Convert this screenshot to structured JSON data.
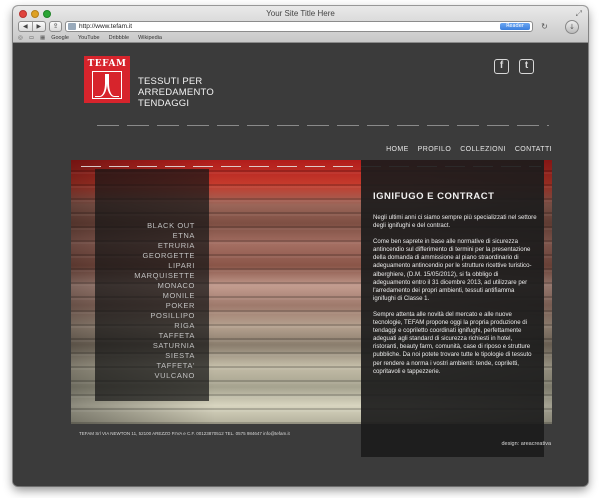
{
  "browser": {
    "window_title": "Your Site Title Here",
    "url": "http://www.tefam.it",
    "reader_label": "Reader",
    "bookmarks": [
      "Google",
      "YouTube",
      "Dribbble",
      "Wikipedia"
    ]
  },
  "site": {
    "logo_text": "TEFAM",
    "brand_lines": [
      "TESSUTI PER",
      "ARREDAMENTO",
      "TENDAGGI"
    ],
    "social": {
      "facebook": "f",
      "twitter": "t"
    },
    "nav": [
      "HOME",
      "PROFILO",
      "COLLEZIONI",
      "CONTATTI"
    ],
    "side_menu": [
      "BLACK OUT",
      "ETNA",
      "ETRURIA",
      "GEORGETTE",
      "LIPARI",
      "MARQUISETTE",
      "MONACO",
      "MONILE",
      "POKER",
      "POSILLIPO",
      "RIGA",
      "TAFFETA",
      "SATURNIA",
      "SIESTA",
      "TAFFETA'",
      "VULCANO"
    ],
    "content": {
      "title": "IGNIFUGO E CONTRACT",
      "paragraphs": [
        "Negli ultimi anni ci siamo sempre più specializzati nel settore degli ignifughi e del contract.",
        "Come ben saprete in base alle normative di sicurezza antincendio sul differimento di termini per la presentazione della domanda di ammissione al piano straordinario di adeguamento antincendio per le strutture ricettive turistico-alberghiere, (D.M. 15/05/2012), si fa obbligo di adeguamento entro il 31 dicembre 2013, ad utilizzare per l'arredamento dei propri ambienti, tessuti antifiamma ignifughi di Classe 1.",
        "Sempre attenta alle novità del mercato e alle nuove tecnologie, TEFAM propone oggi la propria produzione di tendaggi e copriletto coordinati ignifughi, perfettamente adeguati agli standard di sicurezza richiesti in hotel, ristoranti, beauty farm, comunità, case di riposo e strutture pubbliche. Da noi potete trovare tutte le tipologie di tessuto per rendere a norma i vostri ambienti: tende, copriletti, copritavoli e tappezzerie."
      ]
    },
    "footer_info": "TEFAM Srl VIA NEWTON 11, 52100 AREZZO P.IVA e C.F. 00123870512 TEL. 0575 984647 info@tefam.it",
    "footer_design": "design: areacreativa"
  },
  "colors": {
    "brand_red": "#d7242c",
    "page_bg": "#3b3b3b",
    "reader_blue": "#3b7fdd"
  }
}
